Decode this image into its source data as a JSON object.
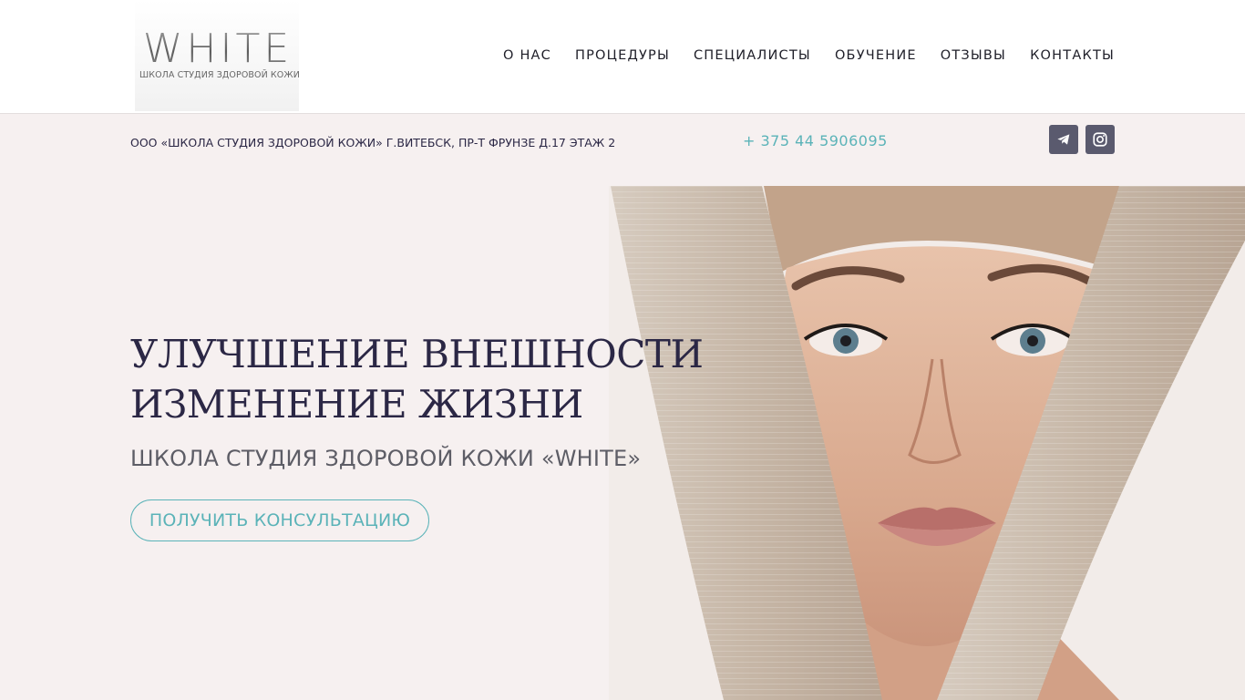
{
  "logo": {
    "word": "WHITE",
    "subtitle": "ШКОЛА СТУДИЯ ЗДОРОВОЙ КОЖИ"
  },
  "nav": {
    "items": [
      {
        "label": "О НАС"
      },
      {
        "label": "ПРОЦЕДУРЫ"
      },
      {
        "label": "СПЕЦИАЛИСТЫ"
      },
      {
        "label": "ОБУЧЕНИЕ"
      },
      {
        "label": "ОТЗЫВЫ"
      },
      {
        "label": "КОНТАКТЫ"
      }
    ]
  },
  "info": {
    "address": "ООО «ШКОЛА СТУДИЯ ЗДОРОВОЙ КОЖИ» Г.ВИТЕБСК, ПР-Т ФРУНЗЕ Д.17 ЭТАЖ 2",
    "phone": "+ 375 44 5906095",
    "social": [
      {
        "icon": "telegram-icon"
      },
      {
        "icon": "instagram-icon"
      }
    ]
  },
  "hero": {
    "title_line1": "УЛУЧШЕНИЕ ВНЕШНОСТИ",
    "title_line2": "ИЗМЕНЕНИЕ ЖИЗНИ",
    "subtitle": "ШКОЛА СТУДИЯ ЗДОРОВОЙ КОЖИ «WHITE»",
    "cta_label": "ПОЛУЧИТЬ КОНСУЛЬТАЦИЮ"
  },
  "colors": {
    "accent": "#5bb3b8",
    "heading": "#2b2745",
    "background": "#f6f0f0",
    "social_bg": "#5a5a6e"
  }
}
